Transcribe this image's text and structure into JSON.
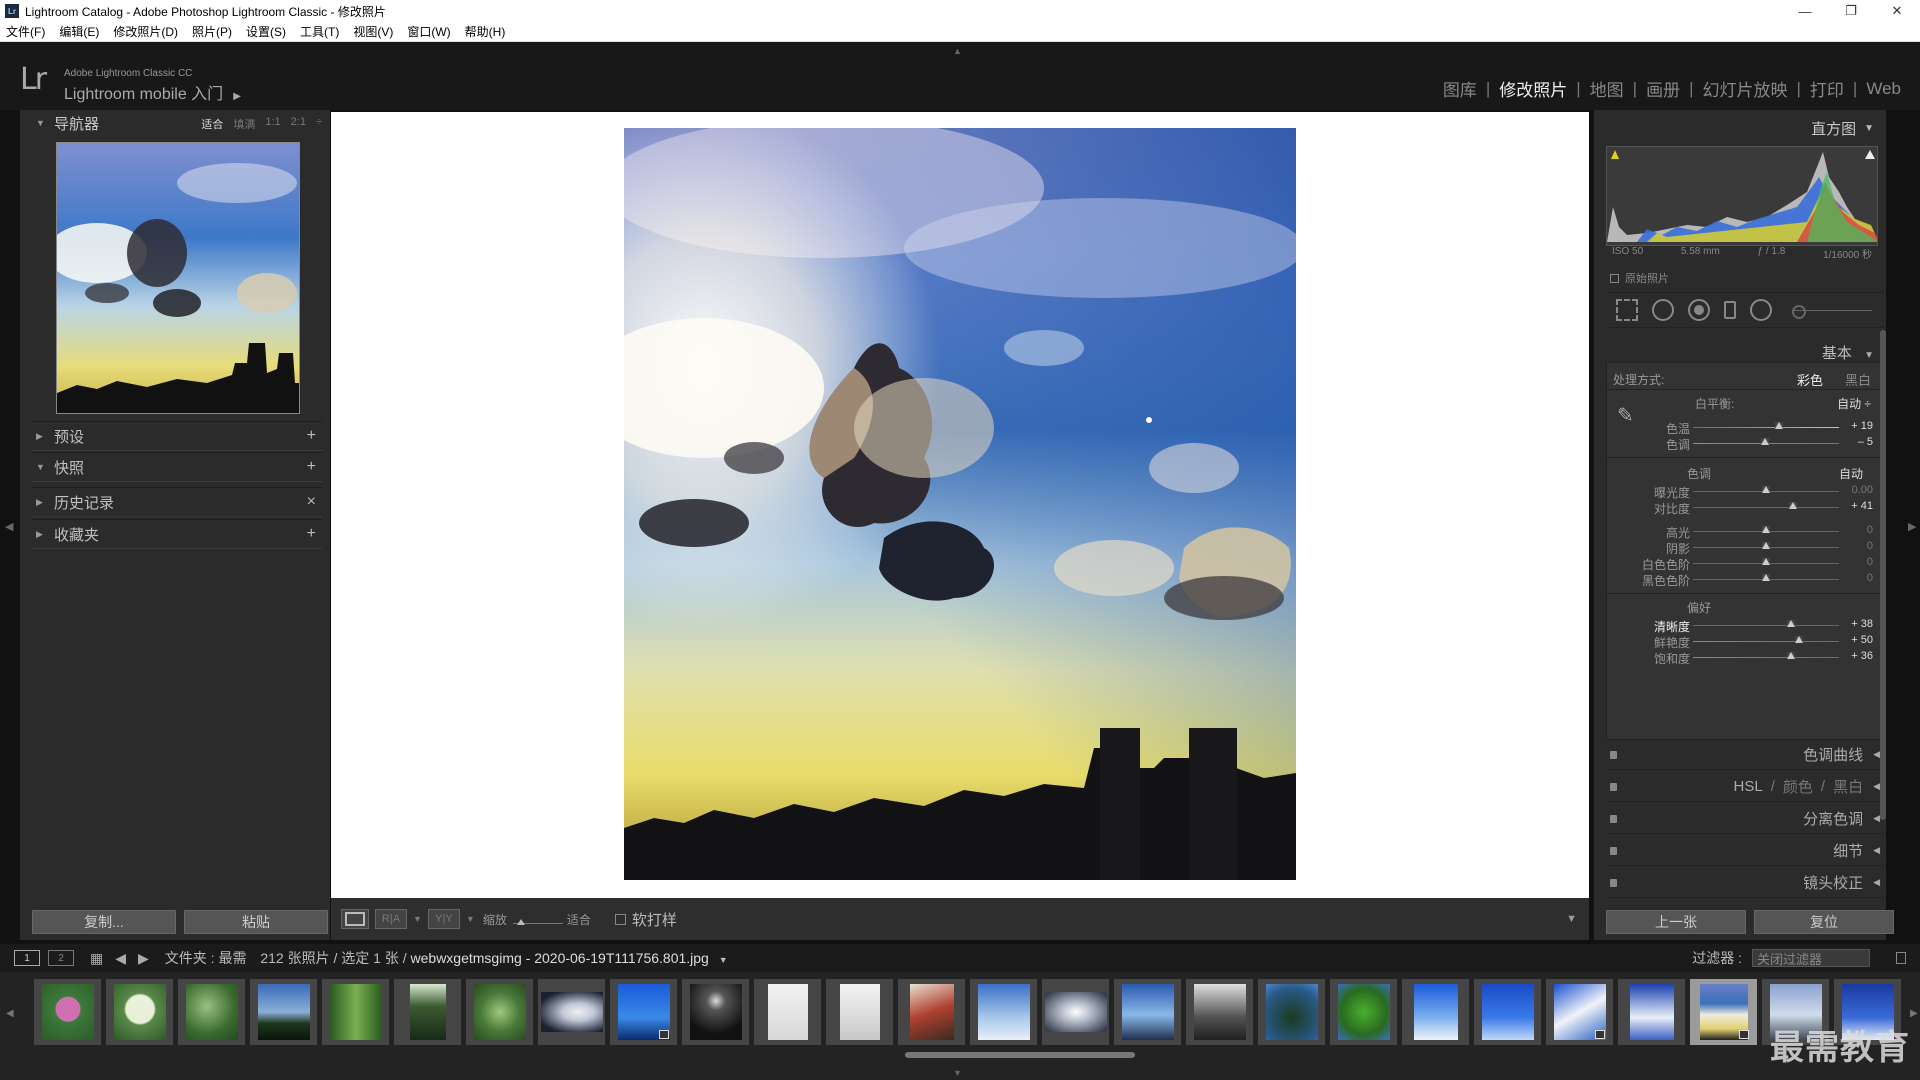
{
  "window": {
    "title": "Lightroom Catalog - Adobe Photoshop Lightroom Classic - 修改照片",
    "app_icon": "Lr",
    "controls": [
      "—",
      "❐",
      "✕"
    ]
  },
  "menu": [
    "文件(F)",
    "编辑(E)",
    "修改照片(D)",
    "照片(P)",
    "设置(S)",
    "工具(T)",
    "视图(V)",
    "窗口(W)",
    "帮助(H)"
  ],
  "header": {
    "logo": "Lr",
    "sub1": "Adobe Lightroom Classic CC",
    "sub2": "Lightroom mobile 入门",
    "modules": [
      {
        "label": "图库",
        "active": false
      },
      {
        "label": "修改照片",
        "active": true
      },
      {
        "label": "地图",
        "active": false
      },
      {
        "label": "画册",
        "active": false
      },
      {
        "label": "幻灯片放映",
        "active": false
      },
      {
        "label": "打印",
        "active": false
      },
      {
        "label": "Web",
        "active": false
      }
    ]
  },
  "left_panel": {
    "navigator_title": "导航器",
    "nav_options": [
      "适合",
      "填满",
      "1:1",
      "2:1"
    ],
    "sections": [
      {
        "label": "预设",
        "action": "+"
      },
      {
        "label": "快照",
        "action": "+"
      },
      {
        "label": "历史记录",
        "action": "×"
      },
      {
        "label": "收藏夹",
        "action": "+"
      }
    ],
    "copy_button": "复制...",
    "paste_button": "粘贴"
  },
  "toolbar": {
    "zoom_label": "缩放",
    "fit_label": "适合",
    "softproof_label": "软打样",
    "ra_label": "R|A",
    "yy_label": "Y|Y"
  },
  "right_panel": {
    "histogram_title": "直方图",
    "exif": {
      "iso": "ISO 50",
      "focal": "5.58 mm",
      "aperture": "ƒ / 1.8",
      "shutter": "1/16000 秒"
    },
    "original_label": "原始照片",
    "basic_title": "基本",
    "treatment_label": "处理方式:",
    "treatment_color": "彩色",
    "treatment_bw": "黑白",
    "wb_label": "白平衡:",
    "wb_value": "自动 ÷",
    "tone_label": "色调",
    "tone_auto": "自动",
    "presence_label": "偏好",
    "sliders": {
      "temp": {
        "label": "色温",
        "value": "+ 19"
      },
      "tint": {
        "label": "色调",
        "value": "– 5"
      },
      "exposure": {
        "label": "曝光度",
        "value": "0.00"
      },
      "contrast": {
        "label": "对比度",
        "value": "+ 41"
      },
      "highlights": {
        "label": "高光",
        "value": "0"
      },
      "shadows": {
        "label": "阴影",
        "value": "0"
      },
      "whites": {
        "label": "白色色阶",
        "value": "0"
      },
      "blacks": {
        "label": "黑色色阶",
        "value": "0"
      },
      "clarity": {
        "label": "清晰度",
        "value": "+ 38"
      },
      "vibrance": {
        "label": "鲜艳度",
        "value": "+ 50"
      },
      "saturation": {
        "label": "饱和度",
        "value": "+ 36"
      }
    },
    "sections": {
      "tone_curve": "色调曲线",
      "hsl": "HSL",
      "hsl_color": "颜色",
      "hsl_bw": "黑白",
      "split_toning": "分离色调",
      "detail": "细节",
      "lens": "镜头校正"
    },
    "prev_button": "上一张",
    "reset_button": "复位"
  },
  "filmbar": {
    "screen1": "1",
    "screen2": "2",
    "folder_label": "文件夹 : 最需",
    "count_label": "212 张照片 / 选定 1 张 /",
    "filename": "webwxgetmsgimg - 2020-06-19T111756.801.jpg",
    "filter_label": "过滤器 :",
    "filter_value": "关闭过滤器"
  },
  "watermark": "最需教育",
  "colors": {
    "accent_active": "#eeeeee",
    "panel_bg": "#2b2b2b",
    "header_bg": "#181818",
    "canvas_bg": "#ffffff"
  }
}
